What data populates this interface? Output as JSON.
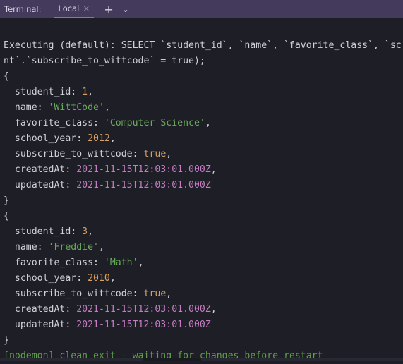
{
  "header": {
    "title": "Terminal:",
    "tab": "Local",
    "close": "×",
    "new_tab": "+",
    "dropdown": "⌄"
  },
  "colors": {
    "header_bg": "#433a5c",
    "bg": "#1e1f26",
    "number": "#dba061",
    "string": "#6aab5c",
    "date": "#c57cc2",
    "nodemon": "#5f9e4a",
    "tab_underline": "#a35fd0"
  },
  "lines": [
    [
      {
        "t": "Executing (default): SELECT `student_id`, `name`, `favorite_class`, `sc",
        "c": "p"
      }
    ],
    [
      {
        "t": "nt`.`subscribe_to_wittcode` = true);",
        "c": "p"
      }
    ],
    [
      {
        "t": "{",
        "c": "p"
      }
    ],
    [
      {
        "t": "  student_id: ",
        "c": "k"
      },
      {
        "t": "1",
        "c": "n"
      },
      {
        "t": ",",
        "c": "p"
      }
    ],
    [
      {
        "t": "  name: ",
        "c": "k"
      },
      {
        "t": "'WittCode'",
        "c": "s"
      },
      {
        "t": ",",
        "c": "p"
      }
    ],
    [
      {
        "t": "  favorite_class: ",
        "c": "k"
      },
      {
        "t": "'Computer Science'",
        "c": "s"
      },
      {
        "t": ",",
        "c": "p"
      }
    ],
    [
      {
        "t": "  school_year: ",
        "c": "k"
      },
      {
        "t": "2012",
        "c": "n"
      },
      {
        "t": ",",
        "c": "p"
      }
    ],
    [
      {
        "t": "  subscribe_to_wittcode: ",
        "c": "k"
      },
      {
        "t": "true",
        "c": "n"
      },
      {
        "t": ",",
        "c": "p"
      }
    ],
    [
      {
        "t": "  createdAt: ",
        "c": "k"
      },
      {
        "t": "2021-11-15T12:03:01.000Z",
        "c": "d"
      },
      {
        "t": ",",
        "c": "p"
      }
    ],
    [
      {
        "t": "  updatedAt: ",
        "c": "k"
      },
      {
        "t": "2021-11-15T12:03:01.000Z",
        "c": "d"
      }
    ],
    [
      {
        "t": "}",
        "c": "p"
      }
    ],
    [
      {
        "t": "{",
        "c": "p"
      }
    ],
    [
      {
        "t": "  student_id: ",
        "c": "k"
      },
      {
        "t": "3",
        "c": "n"
      },
      {
        "t": ",",
        "c": "p"
      }
    ],
    [
      {
        "t": "  name: ",
        "c": "k"
      },
      {
        "t": "'Freddie'",
        "c": "s"
      },
      {
        "t": ",",
        "c": "p"
      }
    ],
    [
      {
        "t": "  favorite_class: ",
        "c": "k"
      },
      {
        "t": "'Math'",
        "c": "s"
      },
      {
        "t": ",",
        "c": "p"
      }
    ],
    [
      {
        "t": "  school_year: ",
        "c": "k"
      },
      {
        "t": "2010",
        "c": "n"
      },
      {
        "t": ",",
        "c": "p"
      }
    ],
    [
      {
        "t": "  subscribe_to_wittcode: ",
        "c": "k"
      },
      {
        "t": "true",
        "c": "n"
      },
      {
        "t": ",",
        "c": "p"
      }
    ],
    [
      {
        "t": "  createdAt: ",
        "c": "k"
      },
      {
        "t": "2021-11-15T12:03:01.000Z",
        "c": "d"
      },
      {
        "t": ",",
        "c": "p"
      }
    ],
    [
      {
        "t": "  updatedAt: ",
        "c": "k"
      },
      {
        "t": "2021-11-15T12:03:01.000Z",
        "c": "d"
      }
    ],
    [
      {
        "t": "}",
        "c": "p"
      }
    ],
    [
      {
        "t": "[nodemon] clean exit - waiting for changes before restart",
        "c": "g"
      }
    ]
  ]
}
